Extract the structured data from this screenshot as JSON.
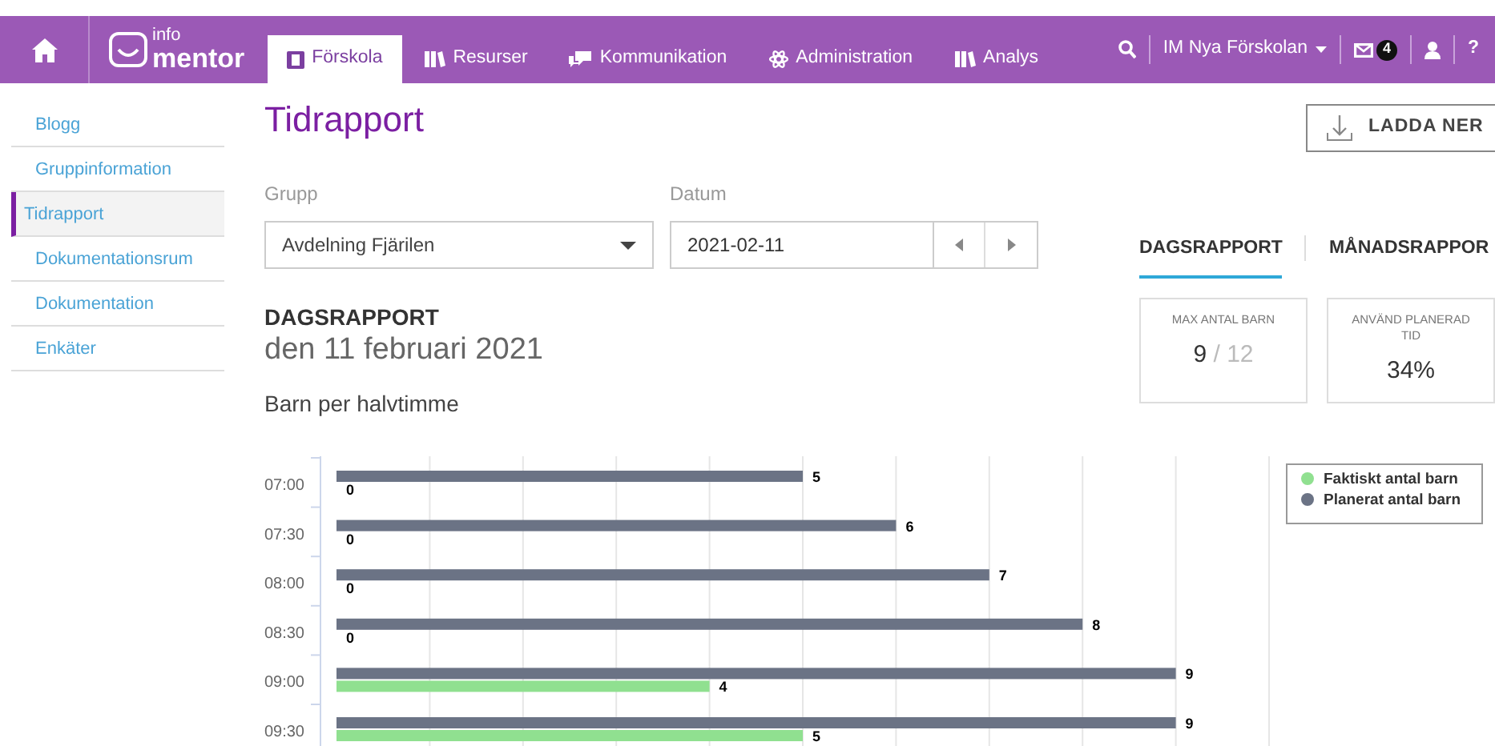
{
  "logo": {
    "small": "info",
    "large": "mentor"
  },
  "nav": {
    "tabs": [
      {
        "label": "Förskola",
        "selected": true
      },
      {
        "label": "Resurser",
        "selected": false
      },
      {
        "label": "Kommunikation",
        "selected": false
      },
      {
        "label": "Administration",
        "selected": false
      },
      {
        "label": "Analys",
        "selected": false
      }
    ],
    "account": "IM Nya Förskolan",
    "mail_count": "4",
    "help": "?"
  },
  "sidebar": {
    "items": [
      {
        "label": "Blogg",
        "selected": false
      },
      {
        "label": "Gruppinformation",
        "selected": false
      },
      {
        "label": "Tidrapport",
        "selected": true
      },
      {
        "label": "Dokumentationsrum",
        "selected": false
      },
      {
        "label": "Dokumentation",
        "selected": false
      },
      {
        "label": "Enkäter",
        "selected": false
      }
    ]
  },
  "page": {
    "title": "Tidrapport",
    "download_button": "LADDA NER"
  },
  "filters": {
    "group": {
      "label": "Grupp",
      "value": "Avdelning Fjärilen"
    },
    "date": {
      "label": "Datum",
      "value": "2021-02-11"
    }
  },
  "report_tabs": [
    {
      "label": "DAGSRAPPORT",
      "selected": true
    },
    {
      "label": "MÅNADSRAPPOR",
      "selected": false
    }
  ],
  "stats": [
    {
      "label": "MAX ANTAL BARN",
      "value": "9",
      "secondary": "/ 12"
    },
    {
      "label": "ANVÄND PLANERAD TID",
      "value": "34%"
    }
  ],
  "report": {
    "heading": "DAGSRAPPORT",
    "date": "den 11 februari 2021",
    "subtitle": "Barn per halvtimme",
    "chart_data": {
      "type": "bar",
      "orientation": "horizontal",
      "categories": [
        "07:00",
        "07:30",
        "08:00",
        "08:30",
        "09:00",
        "09:30"
      ],
      "series": [
        {
          "name": "Planerat antal barn",
          "color": "#6b7385",
          "values": [
            5,
            6,
            7,
            8,
            9,
            9
          ]
        },
        {
          "name": "Faktiskt antal barn",
          "color": "#90e090",
          "values": [
            0,
            0,
            0,
            0,
            4,
            5
          ]
        }
      ],
      "data_labels": true,
      "legend": true
    }
  }
}
